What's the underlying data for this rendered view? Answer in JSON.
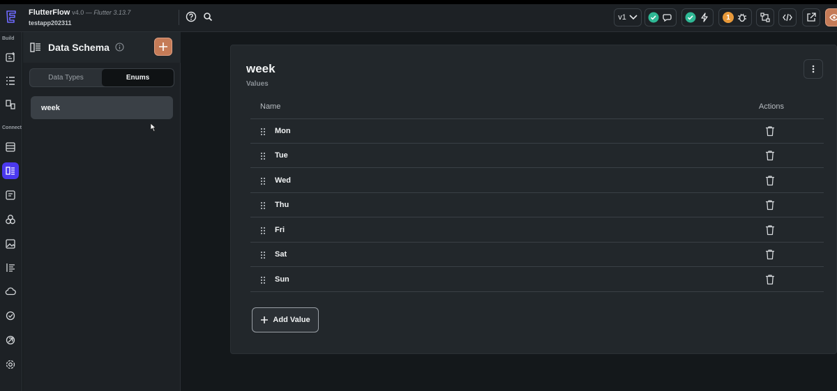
{
  "app": {
    "name": "FlutterFlow",
    "version": "v4.0",
    "flutter_version": "— Flutter 3.13.7",
    "project": "testapp202311"
  },
  "topbar": {
    "version_select": "v1",
    "badge_count": "1"
  },
  "rail": {
    "build_label": "Build",
    "connect_label": "Connect"
  },
  "panel": {
    "title": "Data Schema",
    "tabs": [
      "Data Types",
      "Enums"
    ],
    "selected_tab": "Enums",
    "enums": [
      {
        "label": "week"
      }
    ]
  },
  "enum_detail": {
    "title": "week",
    "subtitle": "Values",
    "columns": {
      "name": "Name",
      "actions": "Actions"
    },
    "values": [
      {
        "label": "Mon"
      },
      {
        "label": "Tue"
      },
      {
        "label": "Wed"
      },
      {
        "label": "Thu"
      },
      {
        "label": "Fri"
      },
      {
        "label": "Sat"
      },
      {
        "label": "Sun"
      }
    ],
    "add_button_label": "Add Value"
  },
  "colors": {
    "accent": "#4b39ef",
    "add_button": "#c57b57",
    "success": "#2fb895",
    "warning": "#e8993a"
  }
}
